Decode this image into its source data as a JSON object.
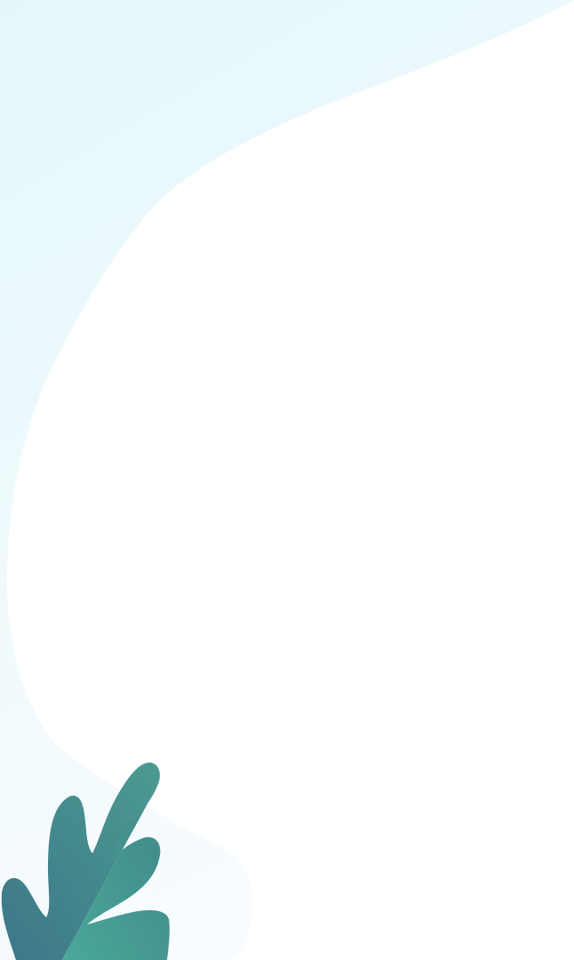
{
  "theme": {
    "background": "#ffffff",
    "wave_top_color": "#e6f8fb",
    "wave_bottom_color": "#f4fbfd",
    "leaf_dark": "#3f7d8a",
    "leaf_light": "#4aa597"
  },
  "decorations": {
    "background_shape": "soft-wave",
    "leaf_icon": "leaf-icon"
  }
}
